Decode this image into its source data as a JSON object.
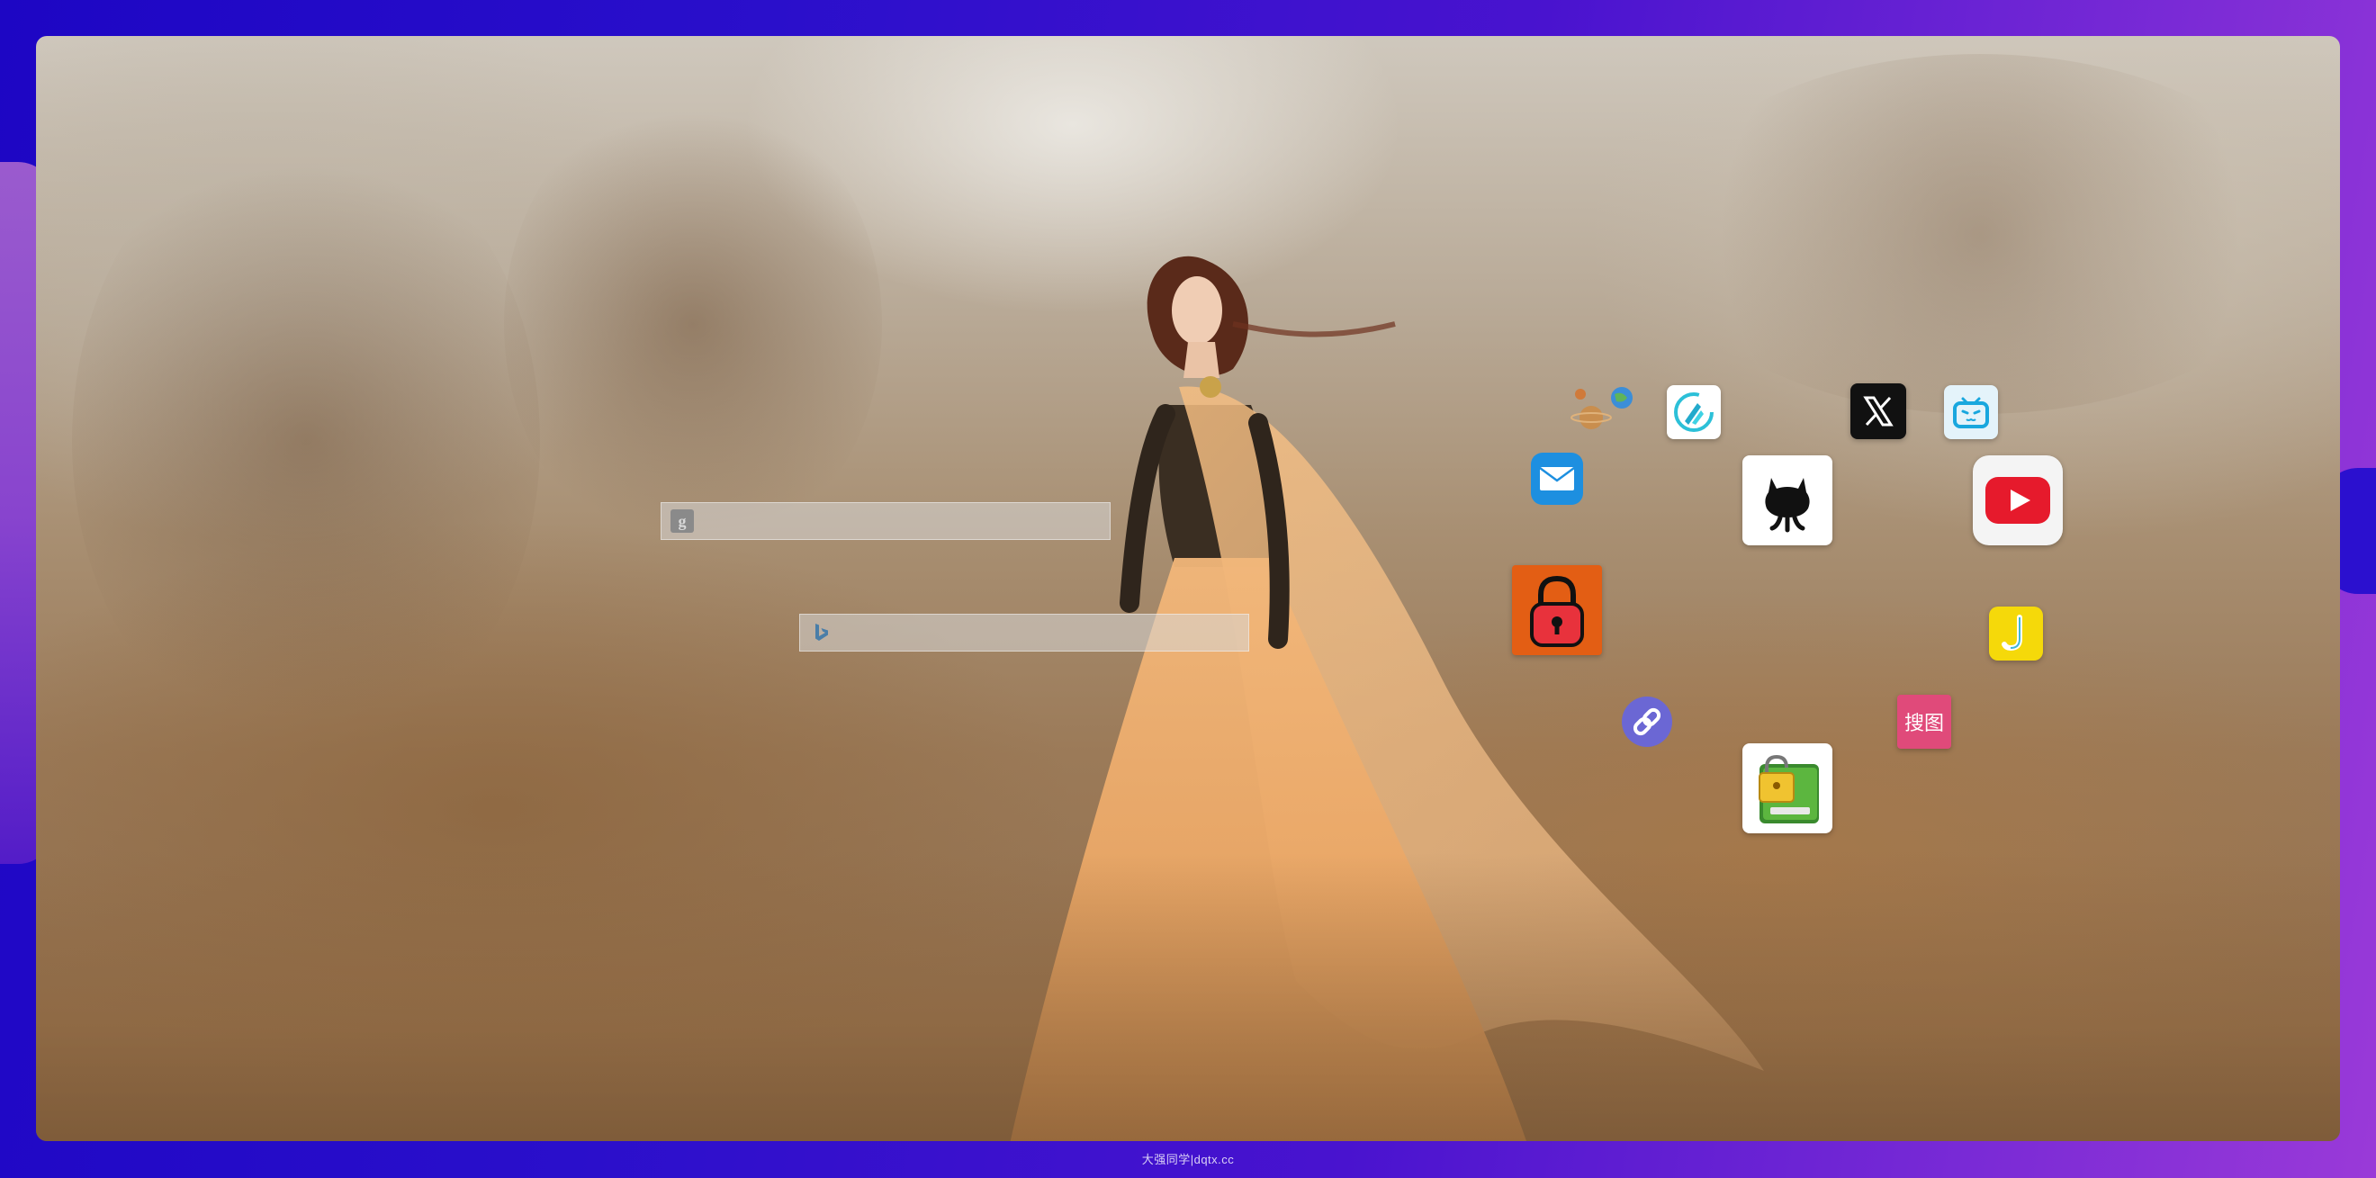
{
  "search": {
    "google": {
      "icon": "google-icon",
      "placeholder": ""
    },
    "bing": {
      "icon": "bing-icon",
      "placeholder": ""
    }
  },
  "apps": [
    {
      "name": "planets-app",
      "icon": "planets-icon"
    },
    {
      "name": "feather-app",
      "icon": "feather-icon"
    },
    {
      "name": "x-app",
      "icon": "x-logo-icon"
    },
    {
      "name": "bilibili-app",
      "icon": "bilibili-tv-icon"
    },
    {
      "name": "mail-app",
      "icon": "mail-icon"
    },
    {
      "name": "github-app",
      "icon": "github-octocat-icon"
    },
    {
      "name": "youtube-app",
      "icon": "youtube-play-icon"
    },
    {
      "name": "lock-app",
      "icon": "padlock-icon"
    },
    {
      "name": "j-app",
      "icon": "j-letter-icon"
    },
    {
      "name": "link-app",
      "icon": "link-icon"
    },
    {
      "name": "soutu-app",
      "icon": "soutu-icon",
      "label": "搜图"
    },
    {
      "name": "notebook-lock-app",
      "icon": "notebook-lock-icon"
    }
  ],
  "footer": {
    "text": "大强同学|dqtx.cc"
  }
}
